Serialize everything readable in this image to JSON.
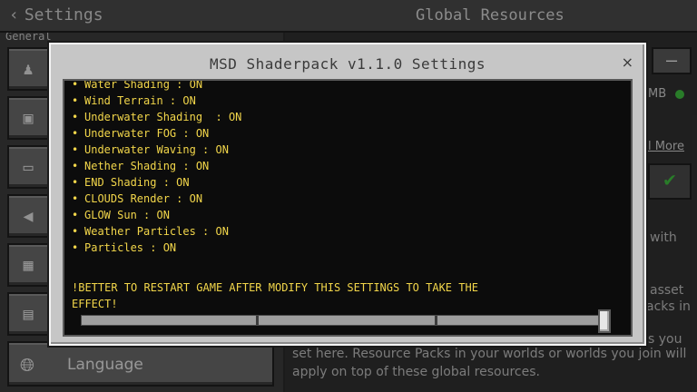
{
  "header": {
    "back_label": "Settings",
    "title": "Global Resources"
  },
  "sidebar": {
    "section_label": "General",
    "language_label": "Language"
  },
  "right_panel": {
    "size_label": "MB",
    "more_label": "l More",
    "fragments": [
      "with",
      "asset",
      "acks in",
      "s you"
    ],
    "description": "set here. Resource Packs in your worlds or worlds you join will apply on top of these global resources."
  },
  "dialog": {
    "title": "MSD Shaderpack v1.1.0 Settings",
    "close_label": "×",
    "options": [
      "Water Shading : ON",
      "Wind Terrain : ON",
      "Underwater Shading  : ON",
      "Underwater FOG : ON",
      "Underwater Waving : ON",
      "Nether Shading : ON",
      "END Shading : ON",
      "CLOUDS Render : ON",
      "GLOW Sun : ON",
      "Weather Particles : ON",
      "Particles : ON"
    ],
    "bullet": "•",
    "warning": "!BETTER TO RESTART GAME AFTER MODIFY THIS SETTINGS TO TAKE THE EFFECT!",
    "scroll_position": 1.0
  },
  "colors": {
    "accent_text": "#f2d64a",
    "status_green": "#3fbf3f"
  }
}
